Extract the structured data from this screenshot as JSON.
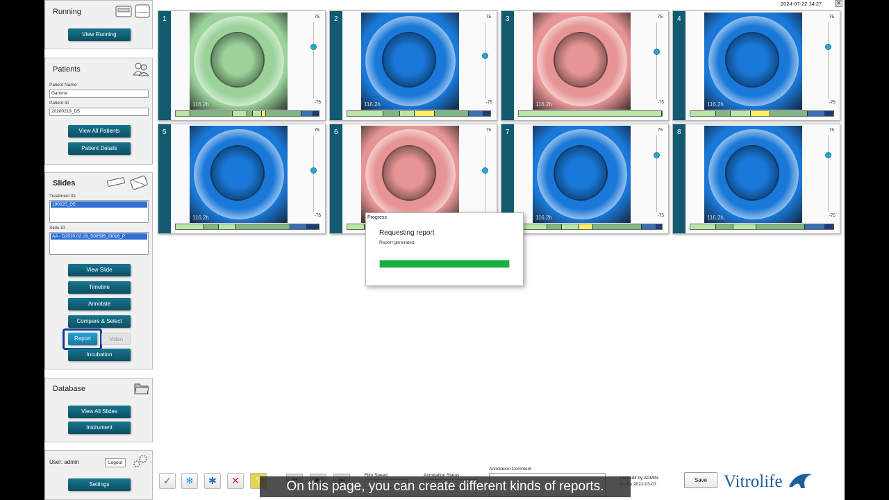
{
  "datetime": "2024-07-22 14:27",
  "running": {
    "title": "Running",
    "view_button": "View Running"
  },
  "patients": {
    "title": "Patients",
    "name_label": "Patient Name",
    "name_value": "Gamma",
    "id_label": "Patient ID",
    "id_value": "20200219_D5",
    "all_button": "View All Patients",
    "details_button": "Patient Details"
  },
  "slides": {
    "title": "Slides",
    "treatment_label": "Treatment ID",
    "treatment_selected": "190220_D5",
    "slide_label": "Slide ID",
    "slide_selected": "AA - D2020.02.19_S00595_I0016_P",
    "buttons": {
      "view_slide": "View Slide",
      "timeline": "Timeline",
      "annotate": "Annotate",
      "compare_select": "Compare & Select",
      "report": "Report",
      "video": "Video",
      "incubation": "Incubation"
    }
  },
  "database": {
    "title": "Database",
    "all_slides_button": "View All Slides",
    "instrument_button": "Instrument"
  },
  "user": {
    "label": "User: admin",
    "logout_button": "Logout",
    "settings_button": "Settings"
  },
  "wells": [
    {
      "number": "1",
      "time": "116.2h",
      "slider_max": "75",
      "slider_min": "-75",
      "slider_level": 0.32,
      "tint": "#9ad29a",
      "timeline": [
        [
          "#b8e7a3",
          10
        ],
        [
          "#7fb77f",
          30
        ],
        [
          "#b8e7a3",
          10
        ],
        [
          "#7fb77f",
          4
        ],
        [
          "#b8e7a3",
          6
        ],
        [
          "#ffee66",
          3
        ],
        [
          "#7fb77f",
          25
        ],
        [
          "#3a6fb5",
          8
        ],
        [
          "#1c3d7a",
          4
        ]
      ]
    },
    {
      "number": "2",
      "time": "116.2h",
      "slider_max": "75",
      "slider_min": "-75",
      "slider_level": 0.44,
      "tint": "#1a78d8",
      "timeline": [
        [
          "#b8e7a3",
          25
        ],
        [
          "#7fb77f",
          12
        ],
        [
          "#b8e7a3",
          10
        ],
        [
          "#ffee66",
          14
        ],
        [
          "#7fb77f",
          24
        ],
        [
          "#3a6fb5",
          10
        ],
        [
          "#1c3d7a",
          5
        ]
      ]
    },
    {
      "number": "3",
      "time": "116.2h",
      "slider_max": "75",
      "slider_min": "-75",
      "slider_level": 0.38,
      "tint": "#e69494",
      "timeline": [
        [
          "#b8e7a3",
          100
        ]
      ]
    },
    {
      "number": "4",
      "time": "116.2h",
      "slider_max": "75",
      "slider_min": "-75",
      "slider_level": 0.32,
      "tint": "#1a78d8",
      "timeline": [
        [
          "#b8e7a3",
          18
        ],
        [
          "#7fb77f",
          10
        ],
        [
          "#b8e7a3",
          14
        ],
        [
          "#ffee66",
          14
        ],
        [
          "#7fb77f",
          26
        ],
        [
          "#3a6fb5",
          12
        ],
        [
          "#1c3d7a",
          6
        ]
      ]
    },
    {
      "number": "5",
      "time": "116.2h",
      "slider_max": "75",
      "slider_min": "-75",
      "slider_level": 0.45,
      "tint": "#1a78d8",
      "timeline": [
        [
          "#b8e7a3",
          20
        ],
        [
          "#7fb77f",
          10
        ],
        [
          "#b8e7a3",
          12
        ],
        [
          "#7fb77f",
          38
        ],
        [
          "#3a6fb5",
          12
        ],
        [
          "#1c3d7a",
          8
        ]
      ]
    },
    {
      "number": "6",
      "time": "116.2h",
      "slider_max": "75",
      "slider_min": "-75",
      "slider_level": 0.45,
      "tint": "#e69494",
      "timeline": [
        [
          "#b8e7a3",
          12
        ],
        [
          "#7fb77f",
          88
        ]
      ]
    },
    {
      "number": "7",
      "time": "116.2h",
      "slider_max": "75",
      "slider_min": "-75",
      "slider_level": 0.25,
      "tint": "#1a78d8",
      "timeline": [
        [
          "#b8e7a3",
          20
        ],
        [
          "#7fb77f",
          10
        ],
        [
          "#b8e7a3",
          12
        ],
        [
          "#ffee66",
          10
        ],
        [
          "#7fb77f",
          34
        ],
        [
          "#3a6fb5",
          10
        ],
        [
          "#1c3d7a",
          4
        ]
      ]
    },
    {
      "number": "8",
      "time": "116.2h",
      "slider_max": "75",
      "slider_min": "-75",
      "slider_level": 0.25,
      "tint": "#1a78d8",
      "timeline": [
        [
          "#b8e7a3",
          18
        ],
        [
          "#7fb77f",
          12
        ],
        [
          "#b8e7a3",
          16
        ],
        [
          "#7fb77f",
          34
        ],
        [
          "#3a6fb5",
          14
        ],
        [
          "#1c3d7a",
          6
        ]
      ]
    }
  ],
  "progress": {
    "title": "Progress",
    "heading": "Requesting report",
    "status": "Report generated.",
    "fraction": 1.0,
    "color": "#12b33c"
  },
  "toolbar": {
    "film_speed_label": "Film Speed",
    "annotation_status_label": "Annotation Status",
    "annotation_comment_label": "Annotation Comment",
    "last_edit": "Last edit by ADMIN",
    "last_edit_date": "on the 2022-03-07",
    "save_label": "Save",
    "icons": [
      "check-icon",
      "snowflake-icon",
      "transfer-icon",
      "cross-icon",
      "question-icon",
      "skip-back-icon",
      "play-icon",
      "skip-forward-icon"
    ]
  },
  "caption": "On this page, you can create different kinds of reports.",
  "brand": {
    "name": "Vitrolife",
    "accent": "#1f5d9b",
    "button_color": "#0f5f78"
  }
}
